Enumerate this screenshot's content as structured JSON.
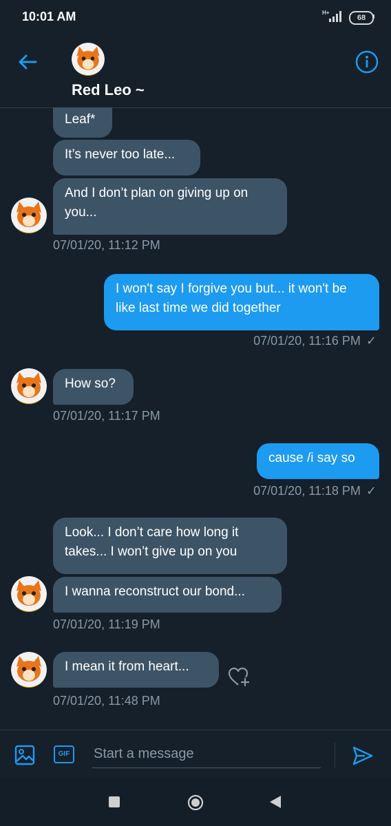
{
  "status_bar": {
    "time": "10:01 AM",
    "network": "H+",
    "battery": "68"
  },
  "header": {
    "title": "Red Leo ~"
  },
  "messages": {
    "m1": "Leaf*",
    "m2": "It’s never too late...",
    "m3": "And I don’t plan on giving up on you...",
    "ts1": "07/01/20, 11:12 PM",
    "m4": "I won't say I forgive you but... it won't be like last time we did together",
    "ts2": "07/01/20, 11:16 PM",
    "m5": "How so?",
    "ts3": "07/01/20, 11:17 PM",
    "m6": "cause /i say so",
    "ts4": "07/01/20, 11:18 PM",
    "m7": "Look... I don’t care how long it takes... I won’t give up on you",
    "m8": "I wanna reconstruct our bond...",
    "ts5": "07/01/20, 11:19 PM",
    "m9": "I mean it from heart...",
    "ts6": "07/01/20, 11:48 PM",
    "check": "✓"
  },
  "composer": {
    "placeholder": "Start a message",
    "gif_label": "GIF"
  },
  "colors": {
    "background": "#15202b",
    "accent": "#1d9bf0",
    "incoming_bubble": "#3d5466",
    "muted_text": "#8899a6"
  },
  "icons": [
    "back-arrow-icon",
    "info-icon",
    "image-icon",
    "gif-icon",
    "send-icon",
    "heart-plus-icon"
  ]
}
